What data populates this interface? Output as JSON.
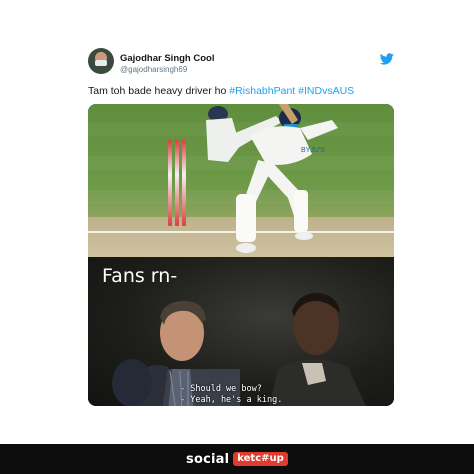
{
  "tweet": {
    "author_name": "Gajodhar Singh Cool",
    "author_handle": "@gajodharsingh69",
    "text_prefix": "Tam toh bade heavy driver ho ",
    "hashtag_1": "#RishabhPant",
    "hashtag_2": "#INDvsAUS",
    "platform_icon": "twitter-bird-icon",
    "accent_color": "#1da1f2"
  },
  "meme": {
    "caption": "Fans rn-",
    "subtitle_line_1": "- Should we bow?",
    "subtitle_line_2": "- Yeah, he's a king."
  },
  "footer": {
    "brand_social": "social",
    "brand_ketchup": "ketc#up",
    "brand_color": "#e23b2e"
  }
}
